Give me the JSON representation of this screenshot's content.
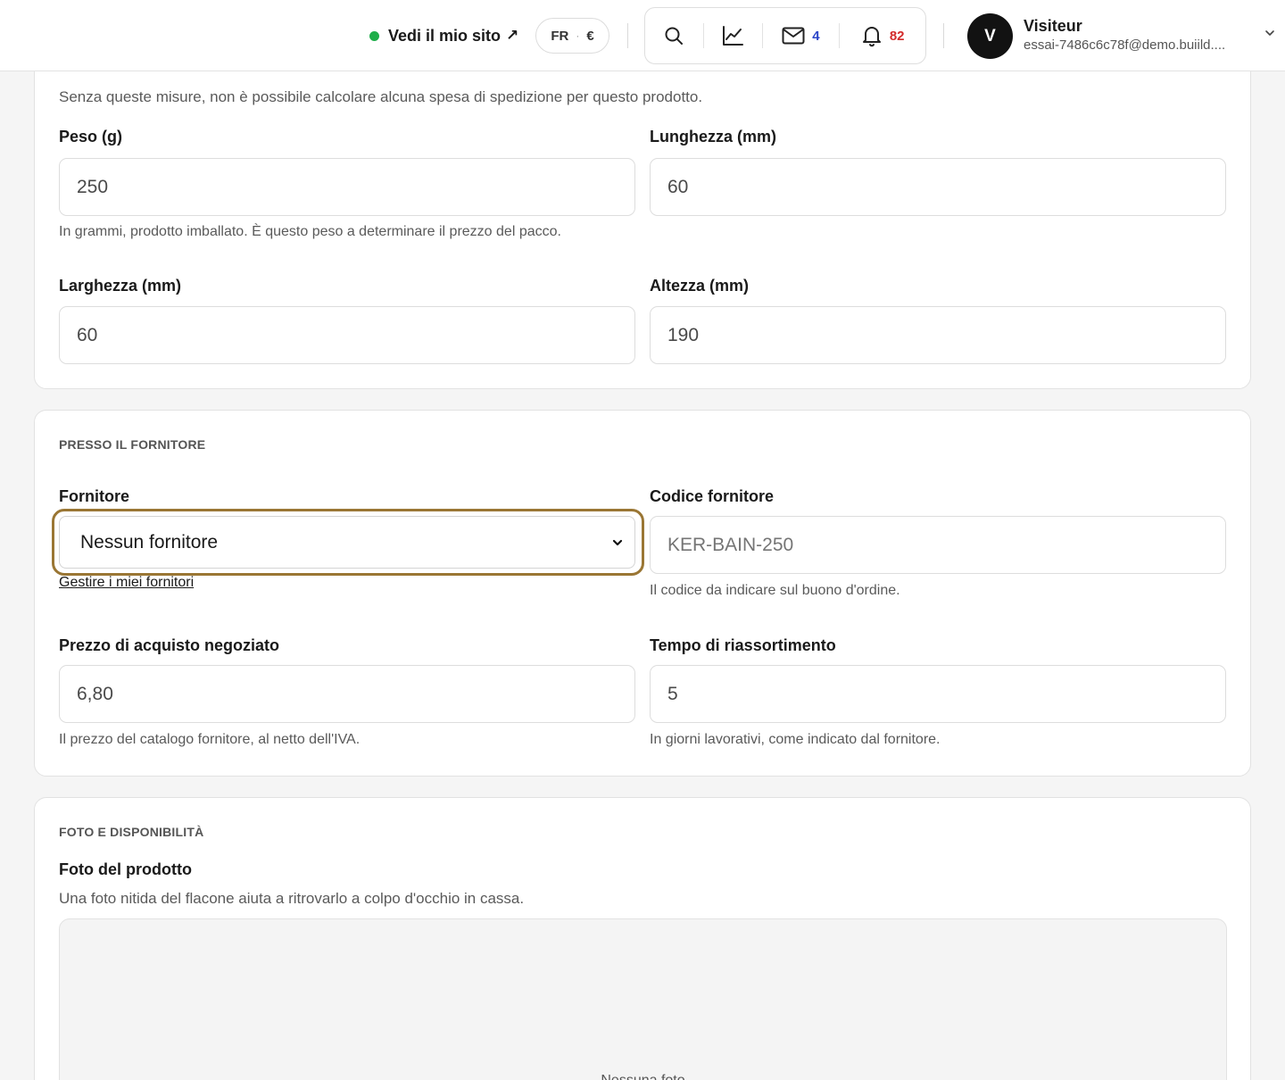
{
  "topbar": {
    "site_link_label": "Vedi il mio sito",
    "site_link_arrow": "↗",
    "locale": {
      "lang": "FR",
      "separator": "·",
      "currency": "€"
    },
    "tools": {
      "messages_count": "4",
      "notifications_count": "82"
    },
    "user": {
      "initial": "V",
      "name": "Visiteur",
      "email": "essai-7486c6c78f@demo.buiild...."
    }
  },
  "dimensions": {
    "intro": "Senza queste misure, non è possibile calcolare alcuna spesa di spedizione per questo prodotto.",
    "weight": {
      "label": "Peso (g)",
      "value": "250",
      "help": "In grammi, prodotto imballato. È questo peso a determinare il prezzo del pacco."
    },
    "length": {
      "label": "Lunghezza (mm)",
      "value": "60"
    },
    "width": {
      "label": "Larghezza (mm)",
      "value": "60"
    },
    "height": {
      "label": "Altezza (mm)",
      "value": "190"
    }
  },
  "supplier": {
    "section_title": "PRESSO IL FORNITORE",
    "supplier_field": {
      "label": "Fornitore",
      "selected": "Nessun fornitore",
      "manage_link": "Gestire i miei fornitori"
    },
    "supplier_code": {
      "label": "Codice fornitore",
      "placeholder": "KER-BAIN-250",
      "help": "Il codice da indicare sul buono d'ordine."
    },
    "purchase_price": {
      "label": "Prezzo di acquisto negoziato",
      "value": "6,80",
      "help": "Il prezzo del catalogo fornitore, al netto dell'IVA."
    },
    "restock_time": {
      "label": "Tempo di riassortimento",
      "value": "5",
      "help": "In giorni lavorativi, come indicato dal fornitore."
    }
  },
  "photo": {
    "section_title": "FOTO E DISPONIBILITÀ",
    "label": "Foto del prodotto",
    "help": "Una foto nitida del flacone aiuta a ritrovarlo a colpo d'occhio in cassa.",
    "empty_text": "Nessuna foto"
  },
  "colors": {
    "accent_focus": "#9a7634",
    "online_dot": "#1fae4a",
    "messages_badge": "#2b45c8",
    "notifications_badge": "#d32b2b"
  },
  "icons": [
    "status-dot-icon",
    "external-link-arrow-icon",
    "search-icon",
    "chart-icon",
    "mail-icon",
    "bell-icon",
    "chevron-down-icon"
  ]
}
